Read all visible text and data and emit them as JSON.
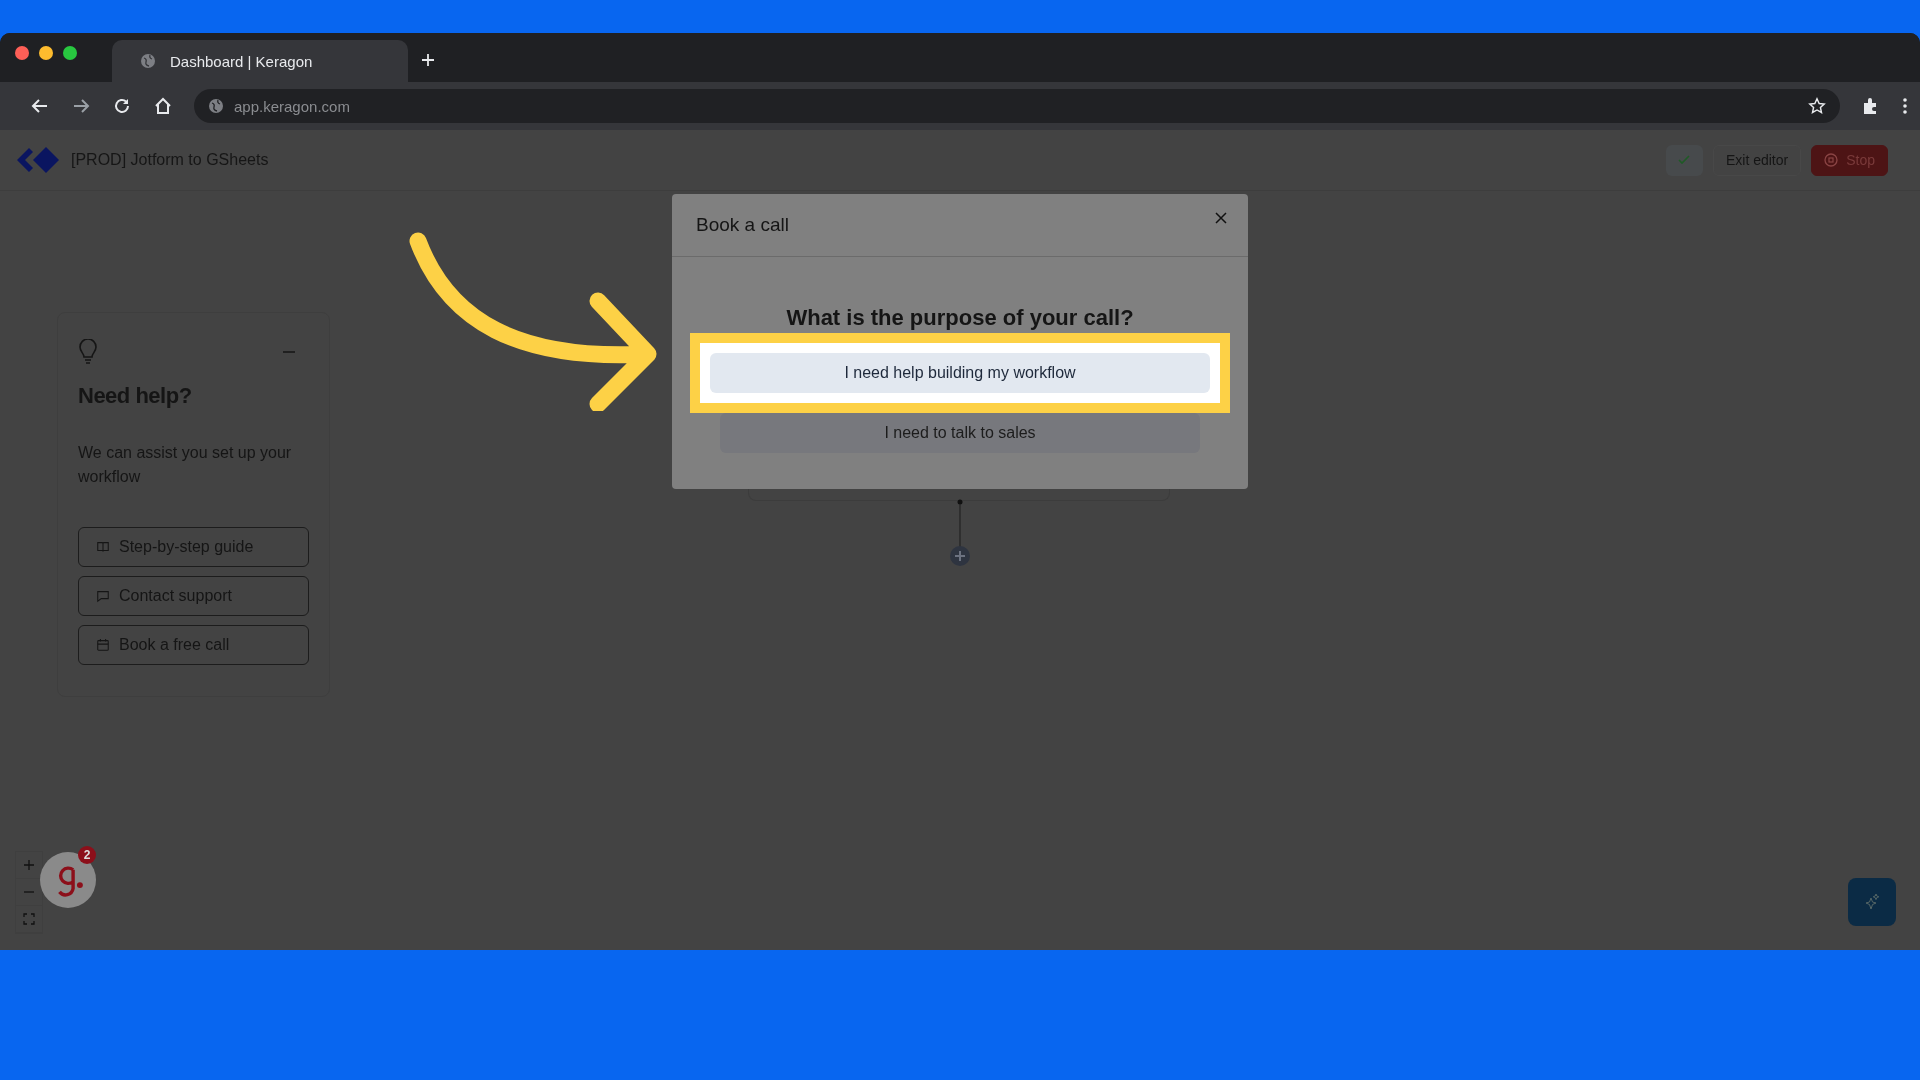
{
  "browser": {
    "tab_title": "Dashboard | Keragon",
    "url": "app.keragon.com"
  },
  "app_header": {
    "workflow_title": "[PROD] Jotform to GSheets",
    "exit_button": "Exit editor",
    "stop_button": "Stop"
  },
  "help_card": {
    "title": "Need help?",
    "text": "We can assist you set up your workflow",
    "actions": [
      {
        "label": "Step-by-step guide",
        "kind": "guide"
      },
      {
        "label": "Contact support",
        "kind": "chat"
      },
      {
        "label": "Book a free call",
        "kind": "calendar"
      }
    ]
  },
  "modal": {
    "title": "Book a call",
    "question": "What is the purpose of your call?",
    "options": [
      {
        "label": "I need help building my workflow",
        "selected": true
      },
      {
        "label": "I need to talk to sales",
        "selected": false
      }
    ]
  },
  "assistant_badge": {
    "count": "2"
  }
}
